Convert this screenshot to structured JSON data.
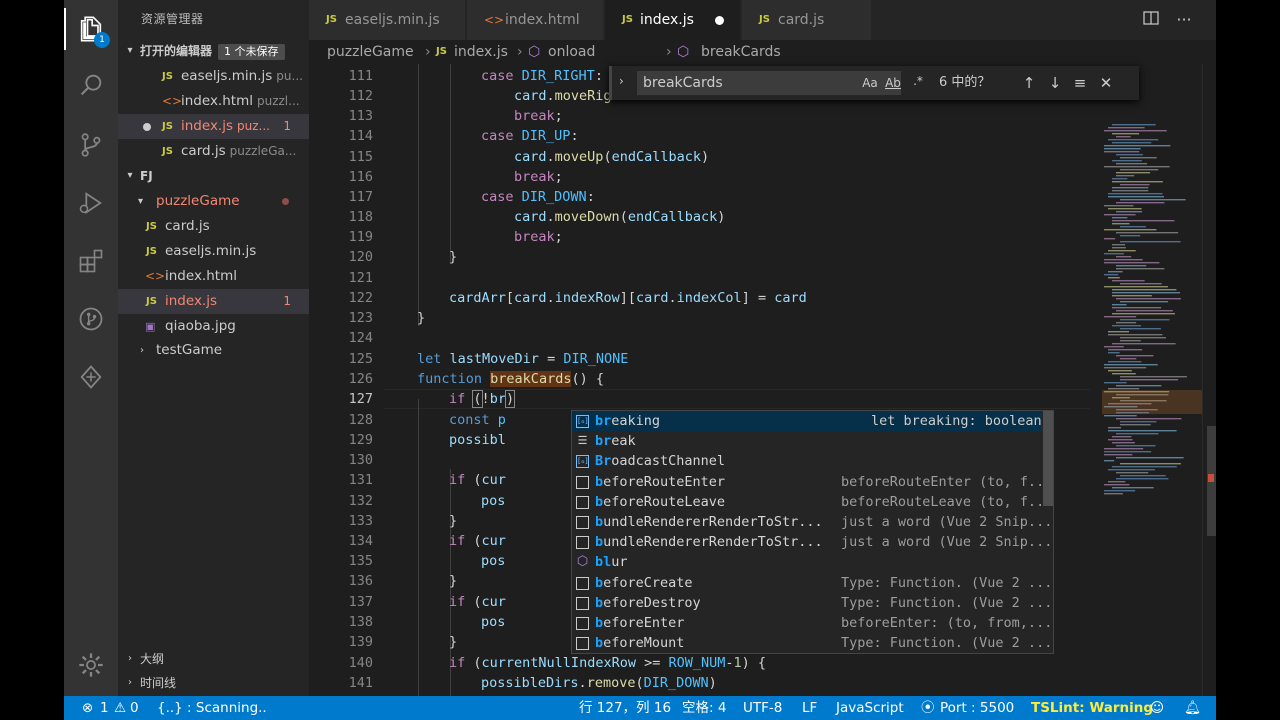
{
  "explorer": {
    "title": "资源管理器",
    "open_editors_label": "打开的编辑器",
    "unsaved_badge": "1 个未保存",
    "open_editors": [
      {
        "name": "easeljs.min.js",
        "path": "pu..."
      },
      {
        "name": "index.html",
        "path": "puzzl..."
      },
      {
        "name": "index.js",
        "path": "puz...",
        "problems": "1"
      },
      {
        "name": "card.js",
        "path": "puzzleGa..."
      }
    ],
    "folder_label": "FJ",
    "folder": {
      "name": "puzzleGame",
      "files": [
        {
          "name": "card.js"
        },
        {
          "name": "easeljs.min.js"
        },
        {
          "name": "index.html"
        },
        {
          "name": "index.js",
          "problems": "1"
        },
        {
          "name": "qiaoba.jpg"
        }
      ],
      "other": "testGame"
    },
    "outline_label": "大纲",
    "timeline_label": "时间线"
  },
  "activity": {
    "explorer_badge": "1"
  },
  "tabs": [
    {
      "label": "easeljs.min.js",
      "icon": "JS"
    },
    {
      "label": "index.html",
      "icon": "<>"
    },
    {
      "label": "index.js",
      "icon": "JS"
    },
    {
      "label": "card.js",
      "icon": "JS"
    }
  ],
  "breadcrumb": {
    "folder": "puzzleGame",
    "file": "index.js",
    "sym1": "onload",
    "sym2": "breakCards"
  },
  "find": {
    "query": "breakCards",
    "match_case": "Aa",
    "whole_word": "Ab",
    "regex": ".*",
    "count": "6 中的？"
  },
  "editor": {
    "line_numbers": [
      "111",
      "112",
      "113",
      "114",
      "115",
      "116",
      "117",
      "118",
      "119",
      "120",
      "121",
      "122",
      "123",
      "124",
      "125",
      "126",
      "127",
      "128",
      "129",
      "130",
      "131",
      "132",
      "133",
      "134",
      "135",
      "136",
      "137",
      "138",
      "139",
      "140",
      "141"
    ]
  },
  "suggest": {
    "items": [
      {
        "pre": "br",
        "rest": "eaking",
        "detail": "let breaking: boolean",
        "kind": "variable"
      },
      {
        "pre": "br",
        "rest": "eak",
        "detail": "",
        "kind": "keyword"
      },
      {
        "pre": "Br",
        "rest": "oadcastChannel",
        "detail": "",
        "kind": "variable"
      },
      {
        "pre": "b",
        "mid": "eforeRouteEnter",
        "detail": "beforeRouteEnter (to, f...",
        "kind": "snippet"
      },
      {
        "pre": "b",
        "mid": "eforeRouteLeave",
        "detail": "beforeRouteLeave (to, f...",
        "kind": "snippet"
      },
      {
        "pre": "b",
        "mid": "undleRendererRenderToStr...",
        "detail": "just a word (Vue 2 Snip...",
        "kind": "snippet"
      },
      {
        "pre": "b",
        "mid": "undleRendererRenderToStr...",
        "detail": "just a word (Vue 2 Snip...",
        "kind": "snippet"
      },
      {
        "pre": "bl",
        "rest": "ur",
        "detail": "",
        "kind": "method"
      },
      {
        "pre": "b",
        "mid": "eforeCreate",
        "detail": "Type: Function. (Vue 2 ...",
        "kind": "snippet"
      },
      {
        "pre": "b",
        "mid": "eforeDestroy",
        "detail": "Type: Function. (Vue 2 ...",
        "kind": "snippet"
      },
      {
        "pre": "b",
        "mid": "eforeEnter",
        "detail": "beforeEnter: (to, from,...",
        "kind": "snippet"
      },
      {
        "pre": "b",
        "mid": "eforeMount",
        "detail": "Type: Function. (Vue 2 ...",
        "kind": "snippet"
      }
    ]
  },
  "status": {
    "errors": "1",
    "warnings": "0",
    "scanning": "{..} : Scanning..",
    "position": "行 127，列 16",
    "spaces": "空格: 4",
    "encoding": "UTF-8",
    "eol": "LF",
    "language": "JavaScript",
    "port": "Port : 5500",
    "tslint": "TSLint: Warning"
  },
  "colors": {
    "statusbar": "#007acc",
    "accent_blue": "#18a3ff",
    "error": "#f48771",
    "js_icon": "#cbcb41",
    "html_icon": "#e37933"
  }
}
